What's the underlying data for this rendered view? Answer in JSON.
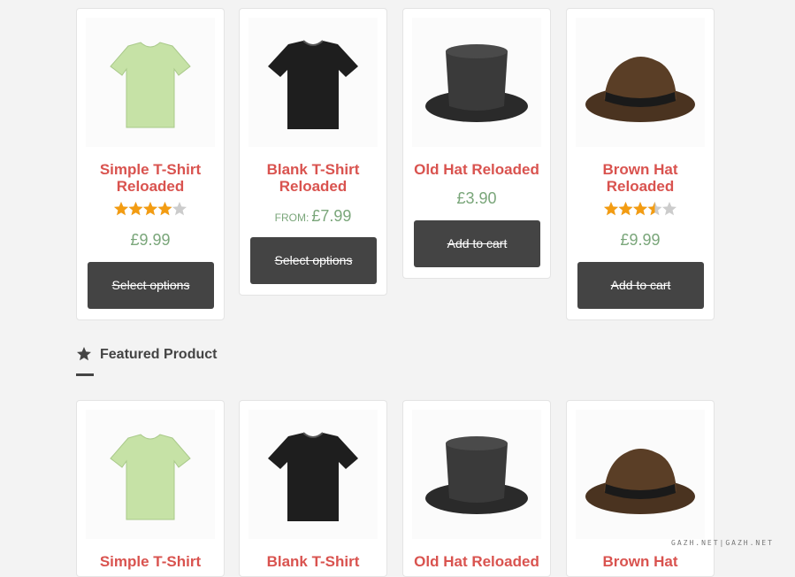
{
  "products_top": [
    {
      "title": "Simple T-Shirt Reloaded",
      "rating": 4,
      "price": "£9.99",
      "button": "Select options"
    },
    {
      "title": "Blank T-Shirt Reloaded",
      "from_label": "FROM:",
      "price": "£7.99",
      "button": "Select options"
    },
    {
      "title": "Old Hat Reloaded",
      "price": "£3.90",
      "button": "Add to cart"
    },
    {
      "title": "Brown Hat Reloaded",
      "rating": 3.5,
      "price": "£9.99",
      "button": "Add to cart"
    }
  ],
  "featured": {
    "heading": "Featured Product",
    "icon": "star-icon",
    "products": [
      {
        "title": "Simple T-Shirt"
      },
      {
        "title": "Blank T-Shirt"
      },
      {
        "title": "Old Hat Reloaded"
      },
      {
        "title": "Brown Hat"
      }
    ]
  },
  "watermark": "GAZH.NET|GAZH.NET",
  "colors": {
    "title": "#d9534f",
    "price": "#7aa67a",
    "button": "#444444",
    "star": "#f39c12",
    "star_empty": "#cccccc"
  }
}
